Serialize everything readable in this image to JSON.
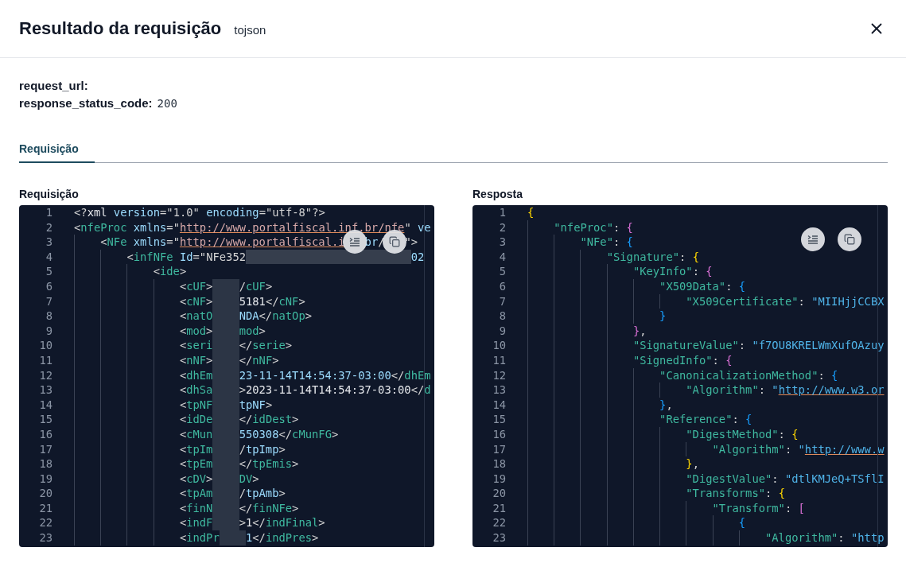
{
  "dialog": {
    "title": "Resultado da requisição",
    "subtitle": "tojson"
  },
  "fields": [
    {
      "label": "request_url:"
    },
    {
      "label": "response_status_code:",
      "value": "200"
    }
  ],
  "tabs": [
    {
      "label": "Requisição",
      "selected": true
    }
  ],
  "panels": [
    {
      "label": "Requisição",
      "kind": "xml",
      "lines": [
        {
          "n": "1",
          "parts": [
            {
              "kind": "code",
              "text": "<?xml version=\"1.0\" encoding=\"utf-8\"?>"
            }
          ]
        },
        {
          "n": "2",
          "parts": [
            {
              "kind": "code",
              "text": "<nfeProc xmlns=\"http://www.portalfiscal.inf.br/nfe\" ve"
            }
          ]
        },
        {
          "n": "3",
          "parts": [
            {
              "kind": "code",
              "text": "    <NFe xmlns=\"http://www.portalfiscal.i"
            },
            {
              "kind": "format"
            },
            {
              "kind": "code",
              "text": "br/"
            },
            {
              "kind": "copy"
            },
            {
              "kind": "code",
              "text": "\">"
            }
          ]
        },
        {
          "n": "4",
          "parts": [
            {
              "kind": "code",
              "text": "        <infNFe Id=\"NFe352"
            },
            {
              "kind": "redacted",
              "wide": true
            },
            {
              "kind": "code",
              "text": "02"
            }
          ]
        },
        {
          "n": "5",
          "parts": [
            {
              "kind": "code",
              "text": "            <ide>"
            }
          ]
        },
        {
          "n": "6",
          "parts": [
            {
              "kind": "code",
              "text": "                <cUF>"
            },
            {
              "kind": "redacted",
              "wide": false
            },
            {
              "kind": "code",
              "text": "/cUF>"
            }
          ]
        },
        {
          "n": "7",
          "parts": [
            {
              "kind": "code",
              "text": "                <cNF>"
            },
            {
              "kind": "redacted",
              "wide": false
            },
            {
              "kind": "code",
              "text": "5181</cNF>"
            }
          ]
        },
        {
          "n": "8",
          "parts": [
            {
              "kind": "code",
              "text": "                <natO"
            },
            {
              "kind": "redacted",
              "wide": false
            },
            {
              "kind": "code",
              "text": "NDA</natOp>"
            }
          ]
        },
        {
          "n": "9",
          "parts": [
            {
              "kind": "code",
              "text": "                <mod>"
            },
            {
              "kind": "redacted",
              "wide": false
            },
            {
              "kind": "code",
              "text": "mod>"
            }
          ]
        },
        {
          "n": "10",
          "parts": [
            {
              "kind": "code",
              "text": "                <seri"
            },
            {
              "kind": "redacted",
              "wide": false
            },
            {
              "kind": "code",
              "text": "</serie>"
            }
          ]
        },
        {
          "n": "11",
          "parts": [
            {
              "kind": "code",
              "text": "                <nNF>"
            },
            {
              "kind": "redacted",
              "wide": false
            },
            {
              "kind": "code",
              "text": "</nNF>"
            }
          ]
        },
        {
          "n": "12",
          "parts": [
            {
              "kind": "code",
              "text": "                <dhEm"
            },
            {
              "kind": "redacted",
              "wide": false
            },
            {
              "kind": "code",
              "text": "23-11-14T14:54:37-03:00</dhEm"
            }
          ]
        },
        {
          "n": "13",
          "parts": [
            {
              "kind": "code",
              "text": "                <dhSa"
            },
            {
              "kind": "redacted",
              "wide": false
            },
            {
              "kind": "code",
              "text": ">2023-11-14T14:54:37-03:00</d"
            }
          ]
        },
        {
          "n": "14",
          "parts": [
            {
              "kind": "code",
              "text": "                <tpNF"
            },
            {
              "kind": "redacted",
              "wide": false
            },
            {
              "kind": "code",
              "text": "tpNF>"
            }
          ]
        },
        {
          "n": "15",
          "parts": [
            {
              "kind": "code",
              "text": "                <idDe"
            },
            {
              "kind": "redacted",
              "wide": false
            },
            {
              "kind": "code",
              "text": "</idDest>"
            }
          ]
        },
        {
          "n": "16",
          "parts": [
            {
              "kind": "code",
              "text": "                <cMun"
            },
            {
              "kind": "redacted",
              "wide": false
            },
            {
              "kind": "code",
              "text": "550308</cMunFG>"
            }
          ]
        },
        {
          "n": "17",
          "parts": [
            {
              "kind": "code",
              "text": "                <tpIm"
            },
            {
              "kind": "redacted",
              "wide": false
            },
            {
              "kind": "code",
              "text": "/tpImp>"
            }
          ]
        },
        {
          "n": "18",
          "parts": [
            {
              "kind": "code",
              "text": "                <tpEm"
            },
            {
              "kind": "redacted",
              "wide": false
            },
            {
              "kind": "code",
              "text": "</tpEmis>"
            }
          ]
        },
        {
          "n": "19",
          "parts": [
            {
              "kind": "code",
              "text": "                <cDV>"
            },
            {
              "kind": "redacted",
              "wide": false
            },
            {
              "kind": "code",
              "text": "DV>"
            }
          ]
        },
        {
          "n": "20",
          "parts": [
            {
              "kind": "code",
              "text": "                <tpAm"
            },
            {
              "kind": "redacted",
              "wide": false
            },
            {
              "kind": "code",
              "text": "/tpAmb>"
            }
          ]
        },
        {
          "n": "21",
          "parts": [
            {
              "kind": "code",
              "text": "                <finN"
            },
            {
              "kind": "redacted",
              "wide": false
            },
            {
              "kind": "code",
              "text": "</finNFe>"
            }
          ]
        },
        {
          "n": "22",
          "parts": [
            {
              "kind": "code",
              "text": "                <indF"
            },
            {
              "kind": "redacted",
              "wide": false
            },
            {
              "kind": "code",
              "text": ">1</indFinal>"
            }
          ]
        },
        {
          "n": "23",
          "parts": [
            {
              "kind": "code",
              "text": "                <indPr"
            },
            {
              "kind": "redacted",
              "wide": false
            },
            {
              "kind": "code",
              "text": "1</indPres>"
            }
          ]
        }
      ]
    },
    {
      "label": "Resposta",
      "kind": "json",
      "lines": [
        {
          "n": "1",
          "parts": [
            {
              "kind": "code",
              "text": "{"
            }
          ]
        },
        {
          "n": "2",
          "parts": [
            {
              "kind": "code",
              "text": "    \"nfeProc\": {"
            }
          ]
        },
        {
          "n": "3",
          "parts": [
            {
              "kind": "code",
              "text": "        \"NFe\": {"
            }
          ]
        },
        {
          "n": "4",
          "parts": [
            {
              "kind": "code",
              "text": "            \"Signature\": {"
            }
          ]
        },
        {
          "n": "5",
          "parts": [
            {
              "kind": "code",
              "text": "                \"KeyInfo\": {"
            }
          ]
        },
        {
          "n": "6",
          "parts": [
            {
              "kind": "code",
              "text": "                    \"X509Data\": {"
            }
          ]
        },
        {
          "n": "7",
          "parts": [
            {
              "kind": "code",
              "text": "                        \"X509Certificate\": \"MIIHjjCCBX"
            }
          ]
        },
        {
          "n": "8",
          "parts": [
            {
              "kind": "code",
              "text": "                    }"
            }
          ]
        },
        {
          "n": "9",
          "parts": [
            {
              "kind": "code",
              "text": "                },"
            }
          ]
        },
        {
          "n": "10",
          "parts": [
            {
              "kind": "code",
              "text": "                \"SignatureValue\": \"f7OU8KRELWmXufOAzuy"
            }
          ]
        },
        {
          "n": "11",
          "parts": [
            {
              "kind": "code",
              "text": "                \"SignedInfo\": {"
            }
          ]
        },
        {
          "n": "12",
          "parts": [
            {
              "kind": "code",
              "text": "                    \"CanonicalizationMethod\": {"
            }
          ]
        },
        {
          "n": "13",
          "parts": [
            {
              "kind": "code",
              "text": "                        \"Algorithm\": \"http://www.w3.or"
            }
          ]
        },
        {
          "n": "14",
          "parts": [
            {
              "kind": "code",
              "text": "                    },"
            }
          ]
        },
        {
          "n": "15",
          "parts": [
            {
              "kind": "code",
              "text": "                    \"Reference\": {"
            }
          ]
        },
        {
          "n": "16",
          "parts": [
            {
              "kind": "code",
              "text": "                        \"DigestMethod\": {"
            }
          ]
        },
        {
          "n": "17",
          "parts": [
            {
              "kind": "code",
              "text": "                            \"Algorithm\": \"http://www.w"
            }
          ]
        },
        {
          "n": "18",
          "parts": [
            {
              "kind": "code",
              "text": "                        },"
            }
          ]
        },
        {
          "n": "19",
          "parts": [
            {
              "kind": "code",
              "text": "                        \"DigestValue\": \"dtlKMJeQ+TSflI"
            }
          ]
        },
        {
          "n": "20",
          "parts": [
            {
              "kind": "code",
              "text": "                        \"Transforms\": {"
            }
          ]
        },
        {
          "n": "21",
          "parts": [
            {
              "kind": "code",
              "text": "                            \"Transform\": ["
            }
          ]
        },
        {
          "n": "22",
          "parts": [
            {
              "kind": "code",
              "text": "                                {"
            }
          ]
        },
        {
          "n": "23",
          "parts": [
            {
              "kind": "code",
              "text": "                                    \"Algorithm\": \"http"
            }
          ]
        }
      ]
    }
  ]
}
